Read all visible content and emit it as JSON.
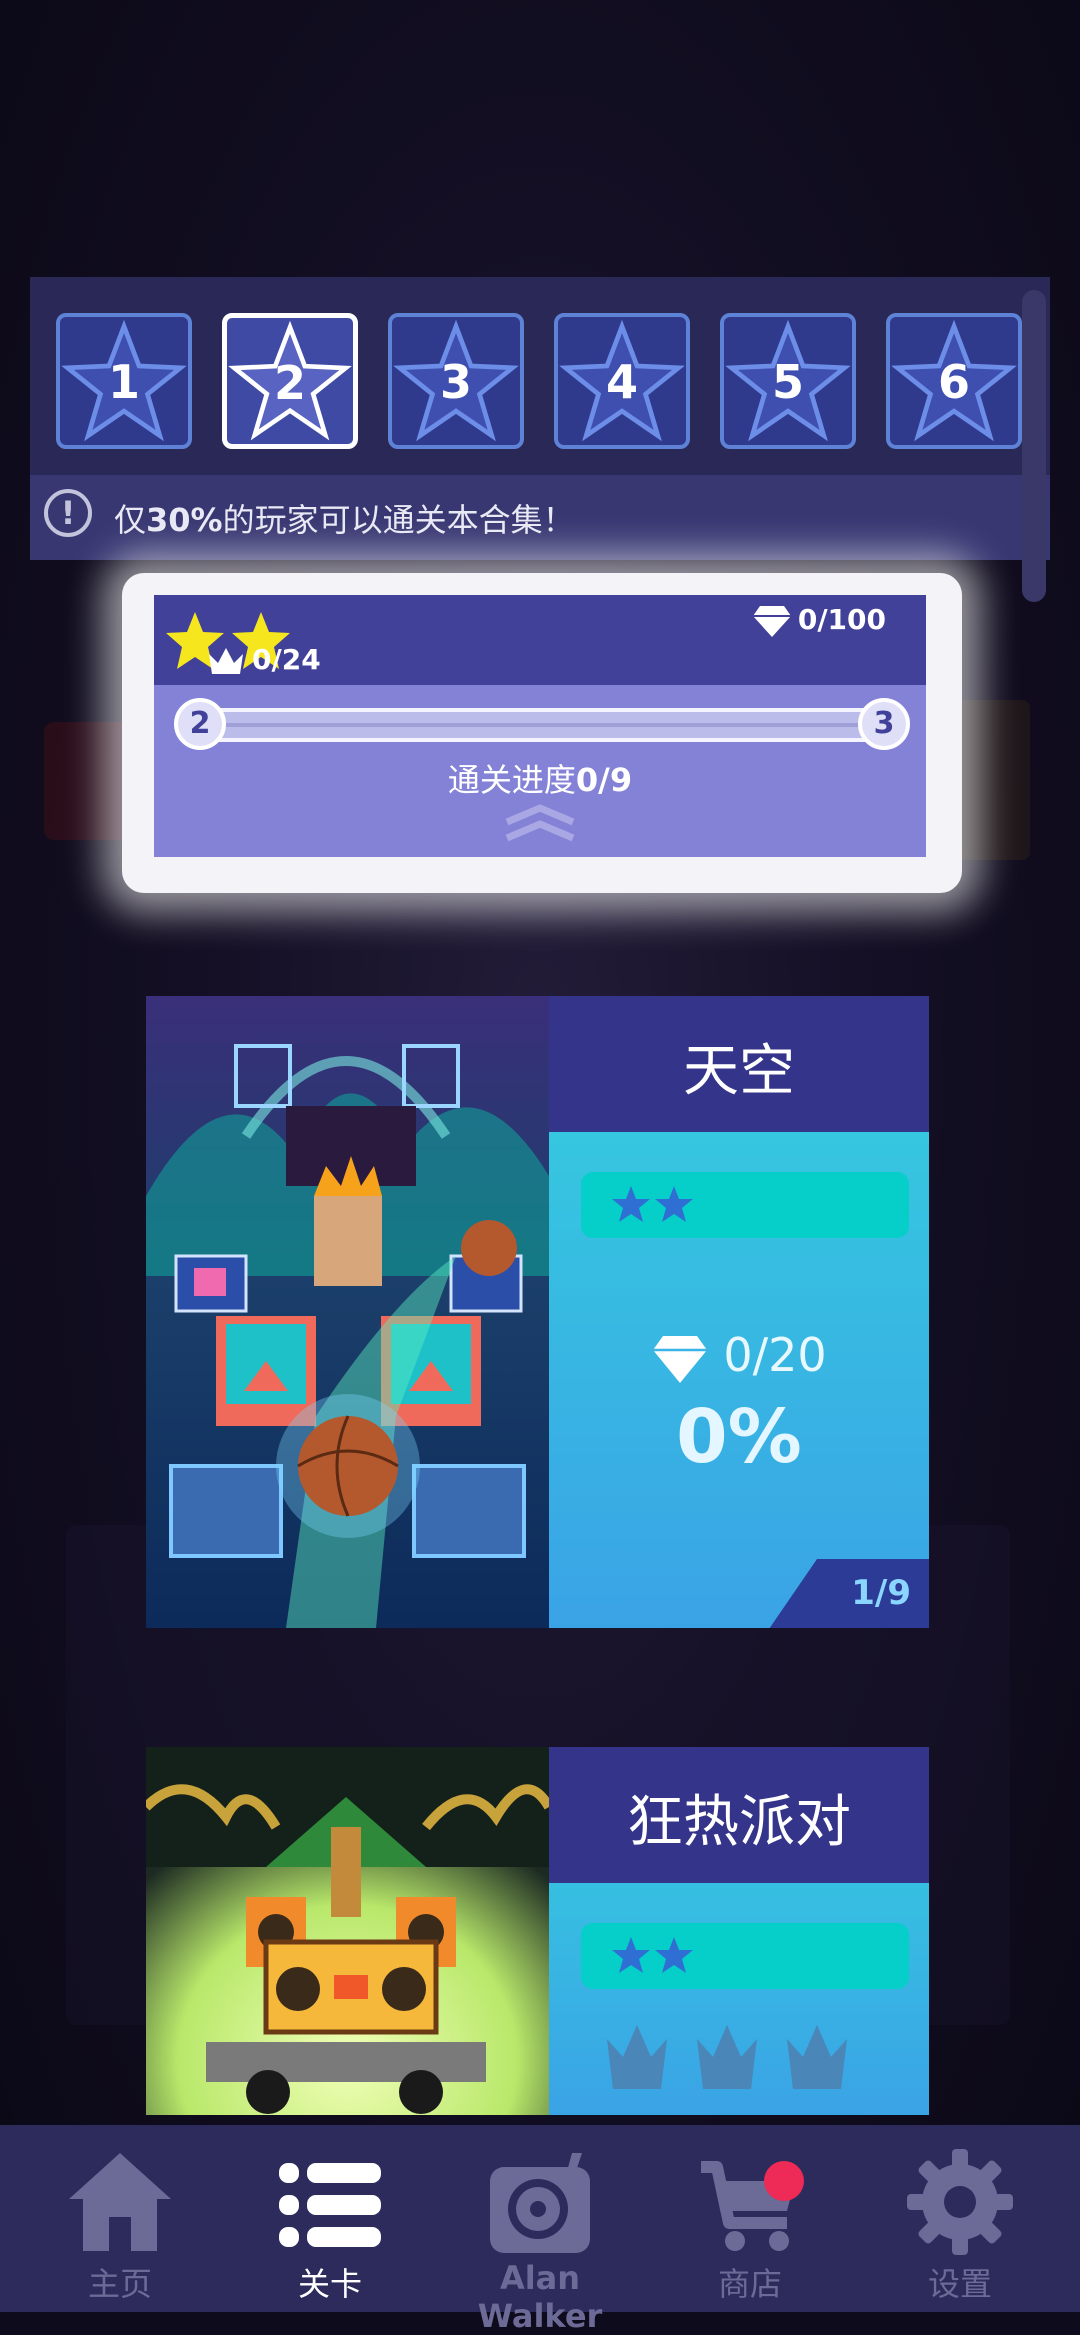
{
  "collections": {
    "tiles": [
      "1",
      "2",
      "3",
      "4",
      "5",
      "6"
    ],
    "selected_index": 1,
    "info_prefix": "仅",
    "info_highlight": "30%",
    "info_suffix": "的玩家可以通关本合集！",
    "info_icon": "!"
  },
  "progress_panel": {
    "stars_earned": 2,
    "gems": "0/100",
    "crowns": "0/24",
    "start_level": "2",
    "end_level": "3",
    "progress_label": "通关进度",
    "progress_value": "0/9",
    "progress_fraction": 0
  },
  "levels": [
    {
      "title": "天空",
      "stars": 2,
      "gems": "0/20",
      "percent": "0%",
      "page": "1/9"
    },
    {
      "title": "狂热派对",
      "stars": 2,
      "crowns_shown": 3
    }
  ],
  "nav": {
    "items": [
      {
        "label": "主页",
        "icon": "home-icon"
      },
      {
        "label": "关卡",
        "icon": "levels-list-icon"
      },
      {
        "label": "Alan Walker",
        "icon": "disc-music-icon"
      },
      {
        "label": "商店",
        "icon": "shop-cart-icon"
      },
      {
        "label": "设置",
        "icon": "gear-icon"
      }
    ],
    "active_index": 1,
    "shop_badge": true
  },
  "colors": {
    "panel": "#2a2857",
    "accent_blue": "#5d82d6",
    "progress_bg": "#8482d6",
    "card_header": "#34348a",
    "star_yellow": "#f6e61e",
    "badge_red": "#ee2a56"
  }
}
